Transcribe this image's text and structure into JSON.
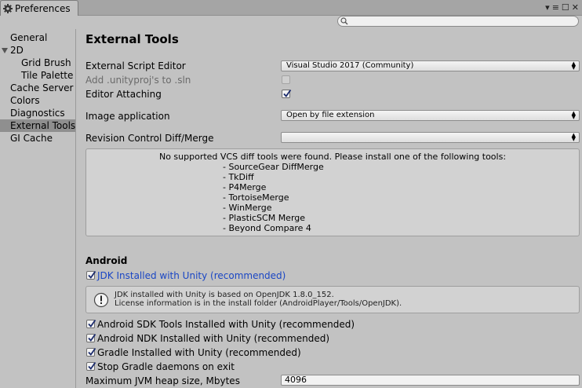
{
  "window": {
    "tab_title": "Preferences",
    "controls": [
      "▾",
      "≡",
      "☐",
      "✕"
    ]
  },
  "search": {
    "placeholder": ""
  },
  "sidebar": {
    "items": [
      {
        "label": "General",
        "indent": 0
      },
      {
        "label": "2D",
        "indent": 0,
        "expanded": true
      },
      {
        "label": "Grid Brush",
        "indent": 1
      },
      {
        "label": "Tile Palette",
        "indent": 1
      },
      {
        "label": "Cache Server",
        "indent": 0
      },
      {
        "label": "Colors",
        "indent": 0
      },
      {
        "label": "Diagnostics",
        "indent": 0
      },
      {
        "label": "External Tools",
        "indent": 0,
        "selected": true
      },
      {
        "label": "GI Cache",
        "indent": 0
      }
    ]
  },
  "main": {
    "title": "External Tools",
    "script_editor": {
      "label": "External Script Editor",
      "value": "Visual Studio 2017 (Community)"
    },
    "add_unityproj": {
      "label": "Add .unityproj's to .sln",
      "checked": false,
      "disabled": true
    },
    "editor_attaching": {
      "label": "Editor Attaching",
      "checked": true
    },
    "image_app": {
      "label": "Image application",
      "value": "Open by file extension"
    },
    "revision_control": {
      "label": "Revision Control Diff/Merge",
      "value": ""
    },
    "vcs_message": {
      "heading": "No supported VCS diff tools were found. Please install one of the following tools:",
      "tools": [
        "- SourceGear DiffMerge",
        "- TkDiff",
        "- P4Merge",
        "- TortoiseMerge",
        "- WinMerge",
        "- PlasticSCM Merge",
        "- Beyond Compare 4"
      ]
    },
    "android": {
      "section_title": "Android",
      "jdk": {
        "label": "JDK Installed with Unity (recommended)",
        "checked": true
      },
      "jdk_info": {
        "line1": "JDK installed with Unity is based on OpenJDK 1.8.0_152.",
        "line2": "License information is in the install folder (AndroidPlayer/Tools/OpenJDK)."
      },
      "sdk": {
        "label": "Android SDK Tools Installed with Unity (recommended)",
        "checked": true
      },
      "ndk": {
        "label": "Android NDK Installed with Unity (recommended)",
        "checked": true
      },
      "gradle": {
        "label": "Gradle Installed with Unity (recommended)",
        "checked": true
      },
      "stop_gradle": {
        "label": "Stop Gradle daemons on exit",
        "checked": true
      },
      "jvm_heap": {
        "label": "Maximum JVM heap size, Mbytes",
        "value": "4096"
      }
    }
  },
  "colors": {
    "background": "#c2c2c2",
    "selected": "#8f8f8f",
    "link": "#1a46c4"
  }
}
